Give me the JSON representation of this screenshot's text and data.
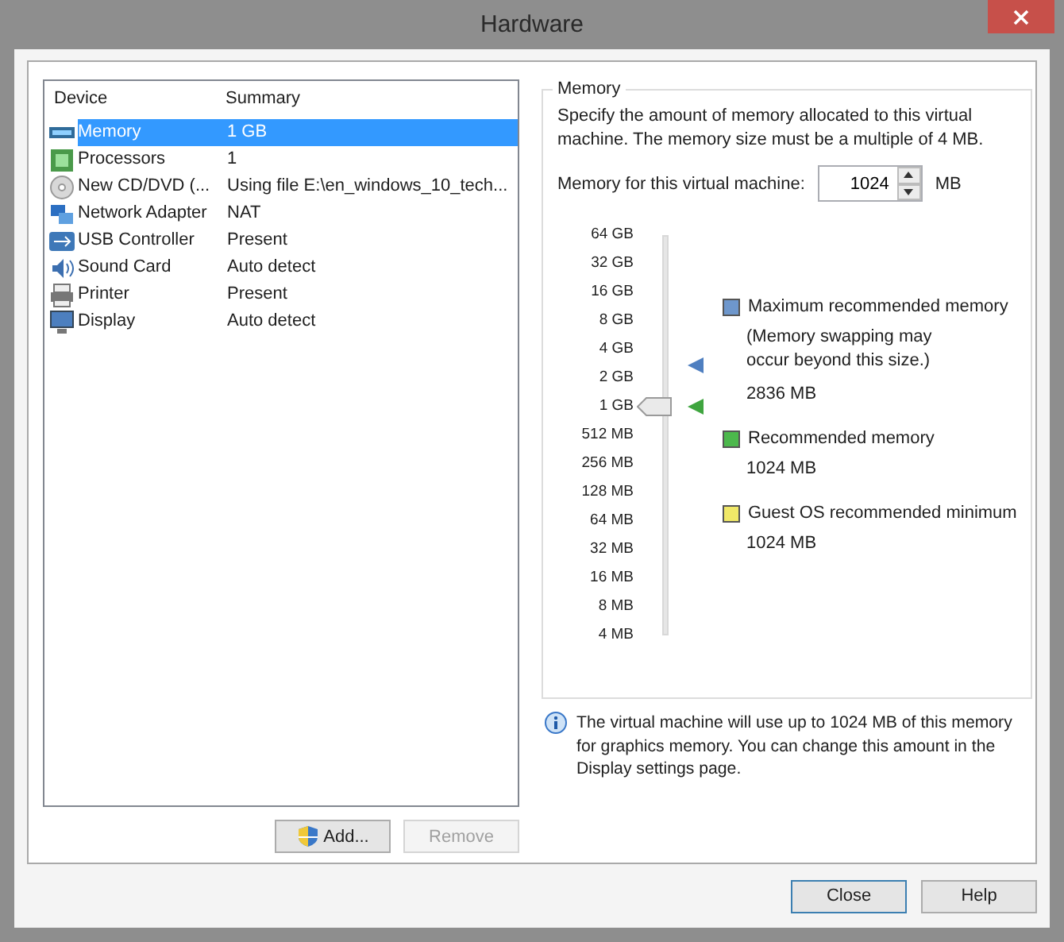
{
  "window": {
    "title": "Hardware"
  },
  "devices": {
    "columns": [
      "Device",
      "Summary"
    ],
    "rows": [
      {
        "device": "Memory",
        "summary": "1 GB",
        "selected": true
      },
      {
        "device": "Processors",
        "summary": "1",
        "selected": false
      },
      {
        "device": "New CD/DVD (...",
        "summary": "Using file E:\\en_windows_10_tech...",
        "selected": false
      },
      {
        "device": "Network Adapter",
        "summary": "NAT",
        "selected": false
      },
      {
        "device": "USB Controller",
        "summary": "Present",
        "selected": false
      },
      {
        "device": "Sound Card",
        "summary": "Auto detect",
        "selected": false
      },
      {
        "device": "Printer",
        "summary": "Present",
        "selected": false
      },
      {
        "device": "Display",
        "summary": "Auto detect",
        "selected": false
      }
    ]
  },
  "device_buttons": [
    {
      "label": "Add...",
      "disabled": false
    },
    {
      "label": "Remove",
      "disabled": true
    }
  ],
  "memory": {
    "legend": "Memory",
    "description": "Specify the amount of memory allocated to this virtual machine. The memory size must be a multiple of 4 MB.",
    "field_label": "Memory for this virtual machine:",
    "value": "1024",
    "unit": "MB",
    "slider": {
      "level": 0.571,
      "ticks": [
        "64 GB",
        "32 GB",
        "16 GB",
        "8 GB",
        "4 GB",
        "2 GB",
        "1 GB",
        "512 MB",
        "256 MB",
        "128 MB",
        "64 MB",
        "32 MB",
        "16 MB",
        "8 MB",
        "4 MB"
      ],
      "markers": [
        {
          "color": "#4f7fc0",
          "level": 0.676
        },
        {
          "color": "#3fa53f",
          "level": 0.571
        }
      ]
    },
    "legend_items": [
      {
        "color": "#6e97cc",
        "title": "Maximum recommended memory",
        "note": "(Memory swapping may occur beyond this size.)",
        "value": "2836 MB"
      },
      {
        "color": "#4cb84c",
        "title": "Recommended memory",
        "value": "1024 MB"
      },
      {
        "color": "#f0e868",
        "title": "Guest OS recommended minimum",
        "value": "1024 MB"
      }
    ]
  },
  "info": "The virtual machine will use up to 1024 MB of this memory for graphics memory. You can change this amount in the Display settings page.",
  "dialog_buttons": [
    {
      "label": "Close",
      "default": true
    },
    {
      "label": "Help",
      "default": false
    }
  ]
}
